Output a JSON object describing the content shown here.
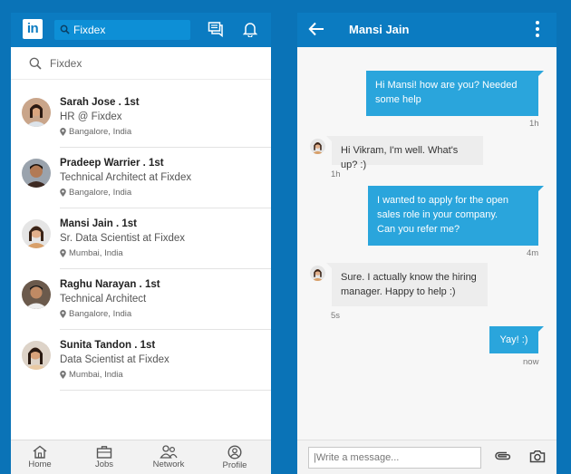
{
  "left": {
    "search_placeholder": "Fixdex",
    "list_search": "Fixdex",
    "contacts": [
      {
        "name": "Sarah Jose  . 1st",
        "title": "HR @ Fixdex",
        "location": "Bangalore, India"
      },
      {
        "name": "Pradeep Warrier  . 1st",
        "title": "Technical Architect at Fixdex",
        "location": "Bangalore, India"
      },
      {
        "name": "Mansi Jain  . 1st",
        "title": "Sr. Data Scientist at Fixdex",
        "location": "Mumbai, India"
      },
      {
        "name": "Raghu Narayan   . 1st",
        "title": "Technical Architect",
        "location": "Bangalore, India"
      },
      {
        "name": "Sunita Tandon  . 1st",
        "title": "Data Scientist at Fixdex",
        "location": "Mumbai, India"
      }
    ],
    "nav": [
      {
        "label": "Home",
        "icon": "home-icon"
      },
      {
        "label": "Jobs",
        "icon": "briefcase-icon"
      },
      {
        "label": "Network",
        "icon": "network-icon"
      },
      {
        "label": "Profile",
        "icon": "profile-icon"
      }
    ],
    "logo_text": "in"
  },
  "right": {
    "contact_name": "Mansi Jain",
    "messages": [
      {
        "from": "me",
        "lines": [
          "Hi Mansi! how are you? Needed",
          "some help"
        ],
        "time": "1h"
      },
      {
        "from": "them",
        "lines": [
          "Hi Vikram, I'm well. What's up? :)"
        ],
        "time": "1h"
      },
      {
        "from": "me",
        "lines": [
          "I wanted to apply for the open",
          "sales role in your company.",
          "Can you refer me?"
        ],
        "time": "4m"
      },
      {
        "from": "them",
        "lines": [
          "Sure. I actually know the hiring",
          "manager. Happy to help :)"
        ],
        "time": "5s"
      },
      {
        "from": "me",
        "lines": [
          "Yay! :)"
        ],
        "time": "now"
      }
    ],
    "composer_placeholder": "|Write a message..."
  },
  "colors": {
    "brand_blue": "#0b7bc1",
    "bubble_blue": "#2aa5dc",
    "bubble_grey": "#ededed",
    "background": "#0a73b7"
  }
}
